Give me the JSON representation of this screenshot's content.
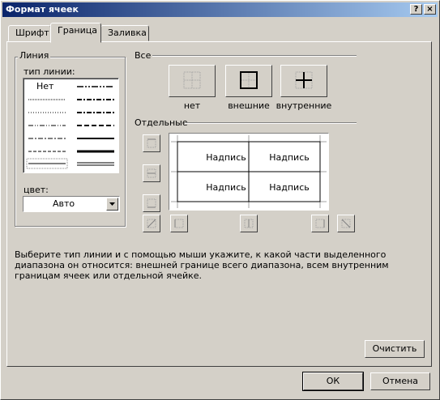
{
  "window": {
    "title": "Формат ячеек",
    "help_glyph": "?",
    "close_glyph": "×"
  },
  "tabs": [
    {
      "label": "Шрифт"
    },
    {
      "label": "Граница"
    },
    {
      "label": "Заливка"
    }
  ],
  "line_group": {
    "title": "Линия",
    "style_label": "тип линии:",
    "none_label": "Нет",
    "color_label": "цвет:",
    "color_value": "Авто"
  },
  "all_group": {
    "title": "Все",
    "presets": [
      {
        "label": "нет"
      },
      {
        "label": "внешние"
      },
      {
        "label": "внутренние"
      }
    ]
  },
  "separate_group": {
    "title": "Отдельные",
    "cells": [
      "Надпись",
      "Надпись",
      "Надпись",
      "Надпись"
    ]
  },
  "hint": "Выберите тип линии и с помощью мыши укажите, к какой части выделенного диапазона он относится: внешней границе всего диапазона, всем внутренним границам ячеек или отдельной ячейке.",
  "buttons": {
    "clear": "Очистить",
    "ok": "ОК",
    "cancel": "Отмена"
  },
  "colors": {
    "title_bar": "#0a246a",
    "face": "#d4d0c8"
  }
}
